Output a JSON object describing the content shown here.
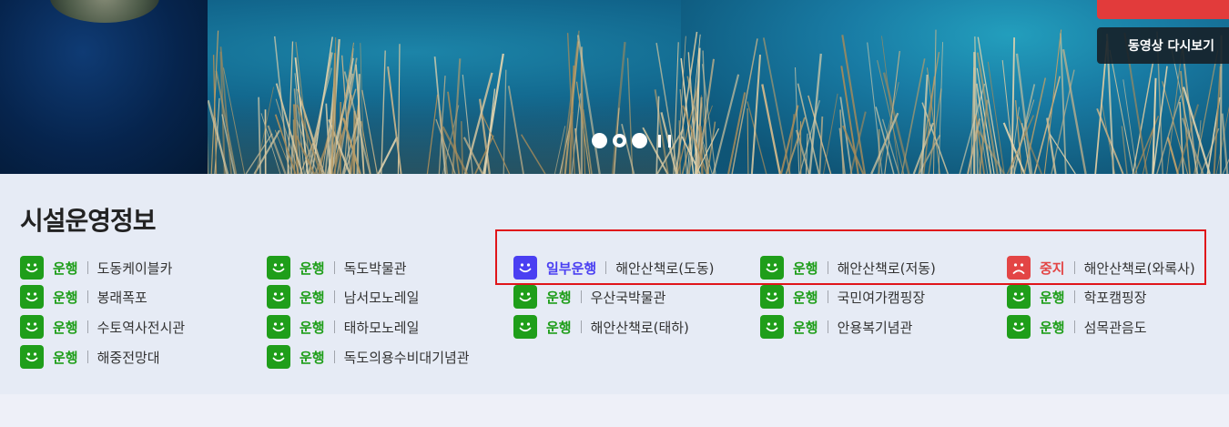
{
  "hero": {
    "replay_label": "동영상 다시보기",
    "slides": 3,
    "active_slide": 2
  },
  "facility": {
    "title": "시설운영정보",
    "items": [
      {
        "status": "운행",
        "name": "도동케이블카",
        "state": "green"
      },
      {
        "status": "운행",
        "name": "독도박물관",
        "state": "green"
      },
      {
        "status": "일부운행",
        "name": "해안산책로(도동)",
        "state": "purple"
      },
      {
        "status": "운행",
        "name": "해안산책로(저동)",
        "state": "green"
      },
      {
        "status": "중지",
        "name": "해안산책로(와록사)",
        "state": "red"
      },
      {
        "status": "운행",
        "name": "봉래폭포",
        "state": "green"
      },
      {
        "status": "운행",
        "name": "남서모노레일",
        "state": "green"
      },
      {
        "status": "운행",
        "name": "우산국박물관",
        "state": "green"
      },
      {
        "status": "운행",
        "name": "국민여가캠핑장",
        "state": "green"
      },
      {
        "status": "운행",
        "name": "학포캠핑장",
        "state": "green"
      },
      {
        "status": "운행",
        "name": "수토역사전시관",
        "state": "green"
      },
      {
        "status": "운행",
        "name": "태하모노레일",
        "state": "green"
      },
      {
        "status": "운행",
        "name": "해안산책로(태하)",
        "state": "green"
      },
      {
        "status": "운행",
        "name": "안용복기념관",
        "state": "green"
      },
      {
        "status": "운행",
        "name": "섬목관음도",
        "state": "green"
      },
      {
        "status": "운행",
        "name": "해중전망대",
        "state": "green"
      },
      {
        "status": "운행",
        "name": "독도의용수비대기념관",
        "state": "green"
      }
    ]
  },
  "colors": {
    "green": "#1f9e1a",
    "purple": "#4a3ff2",
    "red": "#e34545",
    "highlight": "#e0151a"
  }
}
